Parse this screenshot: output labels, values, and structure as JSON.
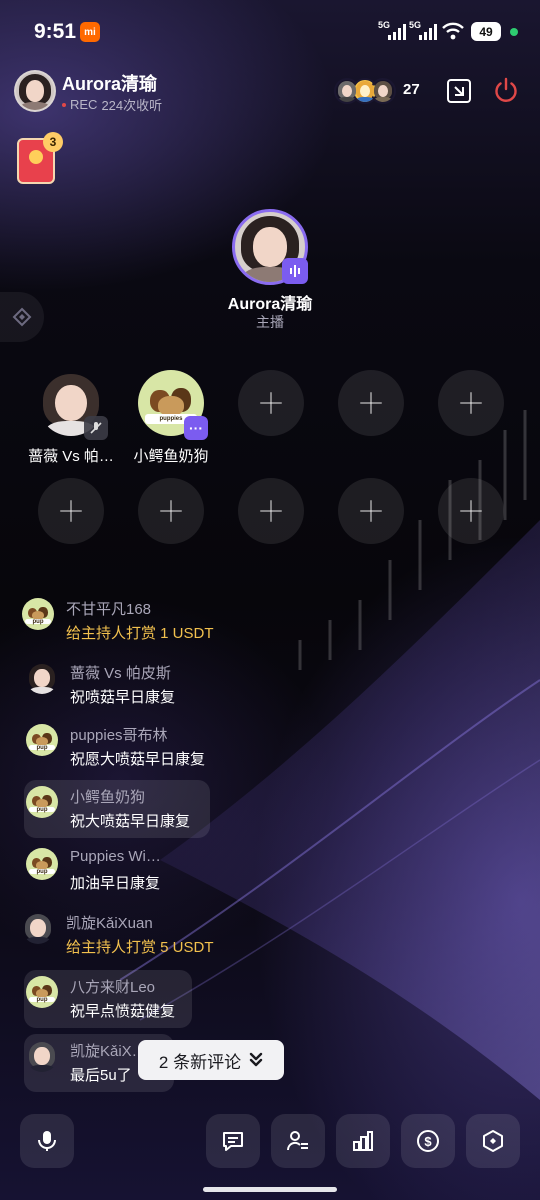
{
  "status_bar": {
    "time": "9:51",
    "network_1": "5G",
    "network_2": "5G",
    "battery": "49"
  },
  "header": {
    "host_name": "Aurora清瑜",
    "rec_label": "REC",
    "favorites": "224次收听",
    "viewer_count": "27"
  },
  "red_packet": {
    "count": "3"
  },
  "stage": {
    "host_name": "Aurora清瑜",
    "host_role": "主播",
    "seats": [
      {
        "name": "蔷薇 Vs 帕…",
        "state": "filled",
        "badge": "muted"
      },
      {
        "name": "小鳄鱼奶狗",
        "state": "filled",
        "badge": "more"
      },
      {
        "name": "",
        "state": "empty"
      },
      {
        "name": "",
        "state": "empty"
      },
      {
        "name": "",
        "state": "empty"
      },
      {
        "name": "",
        "state": "empty"
      },
      {
        "name": "",
        "state": "empty"
      },
      {
        "name": "",
        "state": "empty"
      },
      {
        "name": "",
        "state": "empty"
      },
      {
        "name": "",
        "state": "empty"
      }
    ]
  },
  "chat": [
    {
      "user": "不甘平凡168",
      "text": "给主持人打赏 1 USDT",
      "gift": true,
      "avatar": "dog"
    },
    {
      "user": "蔷薇 Vs 帕皮斯",
      "text": "祝喷菇早日康复",
      "gift": false,
      "avatar": "girl"
    },
    {
      "user": "puppies哥布林",
      "text": "祝愿大喷菇早日康复",
      "gift": false,
      "avatar": "dog"
    },
    {
      "user": "小鳄鱼奶狗",
      "text": "祝大喷菇早日康复",
      "gift": false,
      "avatar": "dog"
    },
    {
      "user": "Puppies Wi…",
      "text": "加油早日康复",
      "gift": false,
      "avatar": "dog"
    },
    {
      "user": "凯旋KǎiXuan",
      "text": "给主持人打赏 5 USDT",
      "gift": true,
      "avatar": "anime"
    },
    {
      "user": "八方来财Leo",
      "text": "祝早点愤菇健复",
      "gift": false,
      "avatar": "dog"
    },
    {
      "user": "凯旋KǎiX…",
      "text": "最后5u了",
      "gift": false,
      "avatar": "anime"
    }
  ],
  "new_comments": {
    "label": "2 条新评论"
  },
  "bottom_bar": {
    "buttons": [
      "mic-icon",
      "comment-icon",
      "user-list-icon",
      "chart-icon",
      "dollar-icon",
      "hexagon-icon"
    ]
  },
  "colors": {
    "accent": "#7b5cf0",
    "gift_text": "#f2c14e",
    "power": "#e04848"
  }
}
